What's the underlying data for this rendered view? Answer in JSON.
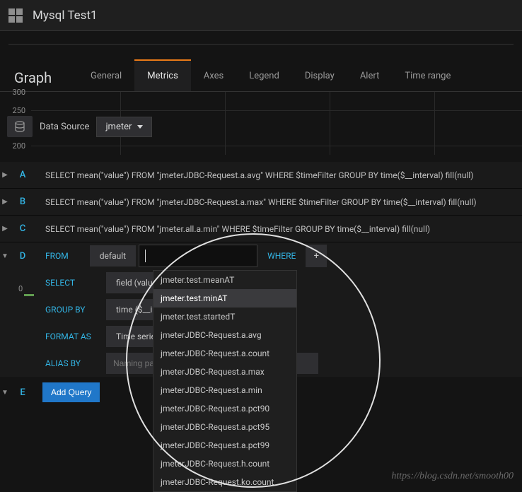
{
  "header": {
    "title": "Mysql Test1"
  },
  "panel": {
    "title": "Graph"
  },
  "tabs": {
    "items": [
      "General",
      "Metrics",
      "Axes",
      "Legend",
      "Display",
      "Alert",
      "Time range"
    ],
    "active": 1
  },
  "yaxis": {
    "top": "300",
    "t250": "250",
    "t200": "200",
    "zero": "0"
  },
  "datasource": {
    "label": "Data Source",
    "value": "jmeter"
  },
  "queries": {
    "a": {
      "letter": "A",
      "sql": "SELECT mean(\"value\") FROM \"jmeterJDBC-Request.a.avg\" WHERE $timeFilter GROUP BY time($__interval) fill(null)"
    },
    "b": {
      "letter": "B",
      "sql": "SELECT mean(\"value\") FROM \"jmeterJDBC-Request.a.max\" WHERE $timeFilter GROUP BY time($__interval) fill(null)"
    },
    "c": {
      "letter": "C",
      "sql": "SELECT mean(\"value\") FROM \"jmeter.all.a.min\" WHERE $timeFilter GROUP BY time($__interval) fill(null)"
    },
    "d": {
      "letter": "D",
      "from": "FROM",
      "default": "default",
      "where": "WHERE",
      "select": "SELECT",
      "field": "field (value)",
      "groupby": "GROUP BY",
      "time": "time ($__interval)",
      "formatas": "FORMAT AS",
      "timeseries": "Time series",
      "aliasby": "ALIAS BY",
      "alias_placeholder": "Naming pattern"
    },
    "e": {
      "letter": "E",
      "add": "Add Query"
    }
  },
  "dropdown": {
    "items": [
      "jmeter.test.meanAT",
      "jmeter.test.minAT",
      "jmeter.test.startedT",
      "jmeterJDBC-Request.a.avg",
      "jmeterJDBC-Request.a.count",
      "jmeterJDBC-Request.a.max",
      "jmeterJDBC-Request.a.min",
      "jmeterJDBC-Request.a.pct90",
      "jmeterJDBC-Request.a.pct95",
      "jmeterJDBC-Request.a.pct99",
      "jmeterJDBC-Request.h.count",
      "jmeterJDBC-Request.ko.count"
    ],
    "highlighted": 1
  },
  "watermark": "https://blog.csdn.net/smooth00"
}
